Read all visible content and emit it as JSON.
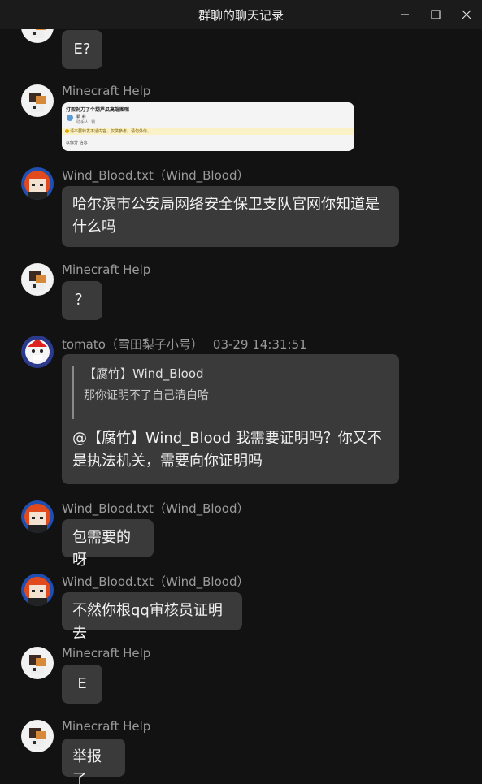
{
  "window": {
    "title": "群聊的聊天记录"
  },
  "messages": [
    {
      "text": "E?"
    },
    {
      "sender": "Minecraft Help",
      "image": {
        "title": "打架剁刀了个葫芦瓜高端图呢",
        "name": "霸 莉",
        "url": "...",
        "sub": "助手人: 霸",
        "warning": "请不要转发不适内容，仅供参考。请勿外传。",
        "footer": "以像分 信息"
      }
    },
    {
      "sender": "Wind_Blood.txt（Wind_Blood）",
      "text": "哈尔滨市公安局网络安全保卫支队官网你知道是什么吗"
    },
    {
      "sender": "Minecraft Help",
      "text": "？"
    },
    {
      "sender": "tomato（雪田梨子小号）",
      "time": "03-29 14:31:51",
      "quote_author": "【腐竹】Wind_Blood",
      "quote_text": "那你证明不了自己清白哈",
      "text": "@【腐竹】Wind_Blood 我需要证明吗？你又不是执法机关，需要向你证明吗"
    },
    {
      "sender": "Wind_Blood.txt（Wind_Blood）",
      "text": "包需要的呀"
    },
    {
      "sender": "Wind_Blood.txt（Wind_Blood）",
      "text": "不然你根qq审核员证明去"
    },
    {
      "sender": "Minecraft Help",
      "text": "E"
    },
    {
      "sender": "Minecraft Help",
      "text": "举报了"
    }
  ]
}
